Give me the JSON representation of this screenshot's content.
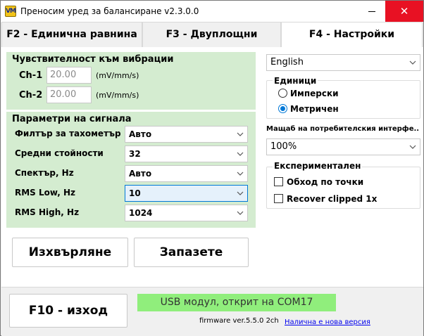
{
  "window": {
    "title": "Преносим уред за балансиране v2.3.0.0",
    "icon_text": "VM",
    "close_glyph": "✕"
  },
  "tabs": [
    {
      "label": "F2 - Единична равнина",
      "active": false
    },
    {
      "label": "F3 - Двуплощни",
      "active": false
    },
    {
      "label": "F4 - Настройки",
      "active": true
    }
  ],
  "vibration": {
    "title": "Чувствителност към вибрации",
    "channels": [
      {
        "label": "Ch-1",
        "value": "20.00",
        "unit": "(mV/mm/s)"
      },
      {
        "label": "Ch-2",
        "value": "20.00",
        "unit": "(mV/mm/s)"
      }
    ]
  },
  "signal": {
    "title": "Параметри на сигнала",
    "rows": [
      {
        "label": "Филтър за тахометър",
        "value": "Авто"
      },
      {
        "label": "Средни стойности",
        "value": "32"
      },
      {
        "label": "Спектър, Hz",
        "value": "Авто"
      },
      {
        "label": "RMS Low, Hz",
        "value": "10"
      },
      {
        "label": "RMS High, Hz",
        "value": "1024"
      }
    ]
  },
  "buttons": {
    "eject": "Изхвърляне",
    "save": "Запазете",
    "exit": "F10 - изход"
  },
  "settings": {
    "language": "English",
    "units": {
      "title": "Единици",
      "options": [
        {
          "label": "Имперски",
          "checked": false
        },
        {
          "label": "Метричен",
          "checked": true
        }
      ]
    },
    "ui_scale_label": "Мащаб на потребителския интерфе...",
    "ui_scale_value": "100%",
    "experimental": {
      "title": "Експериментален",
      "options": [
        {
          "label": "Обход по точки",
          "checked": false
        },
        {
          "label": "Recover clipped 1x",
          "checked": false
        }
      ]
    }
  },
  "status": {
    "usb": "USB модул, открит на COM17",
    "firmware": "firmware ver.5.5.0 2ch",
    "update_link": "Налична е нова версия"
  },
  "colors": {
    "panel_green": "#d4ecd0",
    "status_green": "#90ee7c",
    "accent": "#0078d7",
    "close_red": "#e81123"
  }
}
